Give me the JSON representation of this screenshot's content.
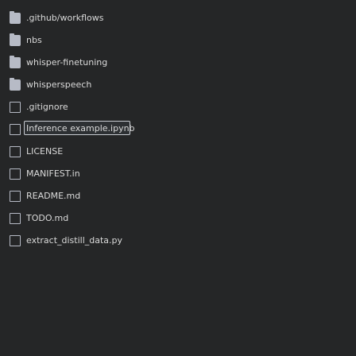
{
  "tree": {
    "items": [
      {
        "type": "folder",
        "label": ".github/workflows",
        "icon": "folder-icon"
      },
      {
        "type": "folder",
        "label": "nbs",
        "icon": "folder-icon"
      },
      {
        "type": "folder",
        "label": "whisper-finetuning",
        "icon": "folder-icon"
      },
      {
        "type": "folder",
        "label": "whisperspeech",
        "icon": "folder-icon"
      },
      {
        "type": "file",
        "label": ".gitignore",
        "icon": "file-icon"
      },
      {
        "type": "file",
        "label": "Inference example.ipynb",
        "icon": "file-icon",
        "selected": true
      },
      {
        "type": "file",
        "label": "LICENSE",
        "icon": "file-icon"
      },
      {
        "type": "file",
        "label": "MANIFEST.in",
        "icon": "file-icon"
      },
      {
        "type": "file",
        "label": "README.md",
        "icon": "file-icon"
      },
      {
        "type": "file",
        "label": "TODO.md",
        "icon": "file-icon"
      },
      {
        "type": "file",
        "label": "extract_distill_data.py",
        "icon": "file-icon"
      }
    ]
  }
}
